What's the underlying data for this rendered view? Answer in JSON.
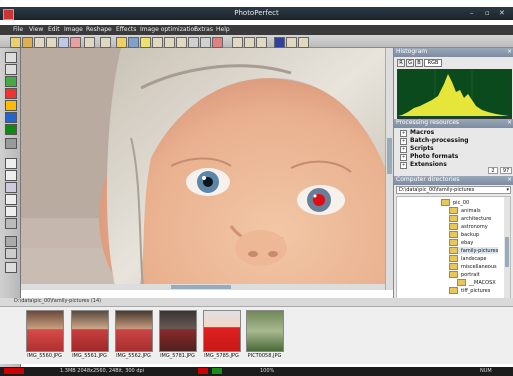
{
  "window": {
    "title": "PhotoPerfect",
    "controls": [
      "–",
      "▫",
      "✕"
    ]
  },
  "menu": [
    "File",
    "View",
    "Edit",
    "Image",
    "Reshape",
    "Effects",
    "Image optimization",
    "Extras",
    "Help"
  ],
  "histogram": {
    "title": "Histogram",
    "channels": [
      "R",
      "G",
      "B",
      "RGB"
    ],
    "selected_channel": "RGB"
  },
  "processing": {
    "title": "Processing resources",
    "items": [
      "Macros",
      "Batch-processing",
      "Scripts",
      "Photo formats",
      "Extensions"
    ],
    "counts": [
      "2",
      "97"
    ]
  },
  "directories": {
    "title": "Computer directories",
    "path": "D:\\data\\pic_00\\family-pictures",
    "tree": [
      "pic_00",
      "animals",
      "architecture",
      "astronomy",
      "backup",
      "ebay",
      "family-pictures",
      "landscape",
      "miscellaneous",
      "portrait",
      "__MACOSX",
      "tiff_pictures"
    ]
  },
  "filmstrip": {
    "path": "D:\\data\\pic_00\\family-pictures (14)",
    "thumbnails": [
      "IMG_5560.JPG",
      "IMG_5561.JPG",
      "IMG_5562.JPG",
      "IMG_5781.JPG",
      "IMG_5785.JPG",
      "PICT0058.JPG"
    ]
  },
  "status": {
    "text": "1.3MB 2048x2560, 24Bit, 300 dpi",
    "zoom": "100%",
    "mode": "NUM"
  }
}
